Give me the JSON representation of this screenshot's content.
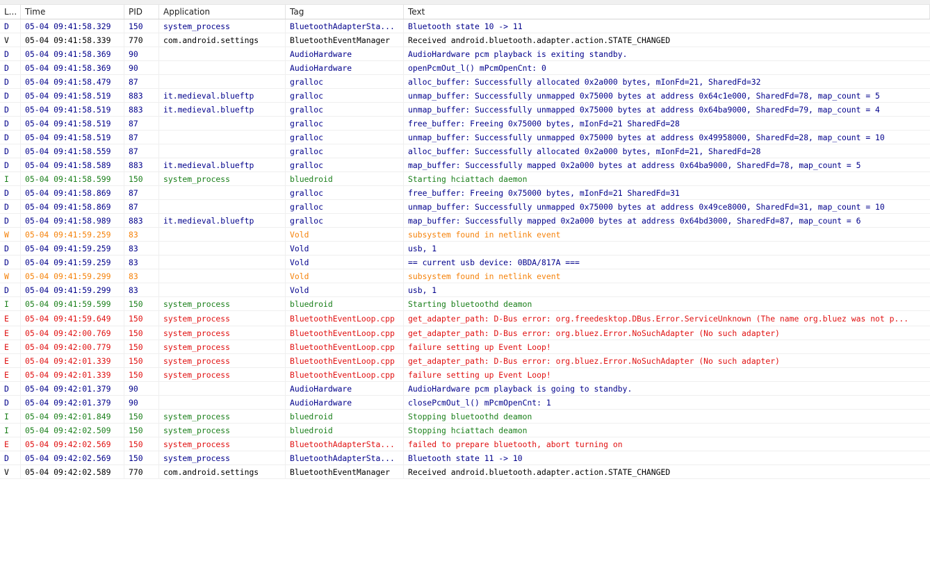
{
  "columns": [
    "L...",
    "Time",
    "PID",
    "Application",
    "Tag",
    "Text"
  ],
  "level_colors": {
    "D": "#00008b",
    "V": "#000000",
    "I": "#1a7f1a",
    "W": "#f5820a",
    "E": "#e01010"
  },
  "rows": [
    {
      "level": "D",
      "time": "05-04 09:41:58.329",
      "pid": "150",
      "app": "system_process",
      "tag": "BluetoothAdapterSta...",
      "text": "Bluetooth state 10 -> 11"
    },
    {
      "level": "V",
      "time": "05-04 09:41:58.339",
      "pid": "770",
      "app": "com.android.settings",
      "tag": "BluetoothEventManager",
      "text": "Received android.bluetooth.adapter.action.STATE_CHANGED"
    },
    {
      "level": "D",
      "time": "05-04 09:41:58.369",
      "pid": "90",
      "app": "",
      "tag": "AudioHardware",
      "text": "AudioHardware pcm playback is exiting standby."
    },
    {
      "level": "D",
      "time": "05-04 09:41:58.369",
      "pid": "90",
      "app": "",
      "tag": "AudioHardware",
      "text": "openPcmOut_l() mPcmOpenCnt: 0"
    },
    {
      "level": "D",
      "time": "05-04 09:41:58.479",
      "pid": "87",
      "app": "",
      "tag": "gralloc",
      "text": "alloc_buffer: Successfully allocated 0x2a000 bytes, mIonFd=21, SharedFd=32"
    },
    {
      "level": "D",
      "time": "05-04 09:41:58.519",
      "pid": "883",
      "app": "it.medieval.blueftp",
      "tag": "gralloc",
      "text": "unmap_buffer: Successfully unmapped 0x75000 bytes at address 0x64c1e000, SharedFd=78, map_count = 5"
    },
    {
      "level": "D",
      "time": "05-04 09:41:58.519",
      "pid": "883",
      "app": "it.medieval.blueftp",
      "tag": "gralloc",
      "text": "unmap_buffer: Successfully unmapped 0x75000 bytes at address 0x64ba9000, SharedFd=79, map_count = 4"
    },
    {
      "level": "D",
      "time": "05-04 09:41:58.519",
      "pid": "87",
      "app": "",
      "tag": "gralloc",
      "text": "free_buffer: Freeing 0x75000 bytes, mIonFd=21 SharedFd=28"
    },
    {
      "level": "D",
      "time": "05-04 09:41:58.519",
      "pid": "87",
      "app": "",
      "tag": "gralloc",
      "text": "unmap_buffer: Successfully unmapped 0x75000 bytes at address 0x49958000, SharedFd=28, map_count = 10"
    },
    {
      "level": "D",
      "time": "05-04 09:41:58.559",
      "pid": "87",
      "app": "",
      "tag": "gralloc",
      "text": "alloc_buffer: Successfully allocated 0x2a000 bytes, mIonFd=21, SharedFd=28"
    },
    {
      "level": "D",
      "time": "05-04 09:41:58.589",
      "pid": "883",
      "app": "it.medieval.blueftp",
      "tag": "gralloc",
      "text": "map_buffer: Successfully mapped 0x2a000 bytes at address 0x64ba9000, SharedFd=78, map_count = 5"
    },
    {
      "level": "I",
      "time": "05-04 09:41:58.599",
      "pid": "150",
      "app": "system_process",
      "tag": "bluedroid",
      "text": "Starting hciattach daemon"
    },
    {
      "level": "D",
      "time": "05-04 09:41:58.869",
      "pid": "87",
      "app": "",
      "tag": "gralloc",
      "text": "free_buffer: Freeing 0x75000 bytes, mIonFd=21 SharedFd=31"
    },
    {
      "level": "D",
      "time": "05-04 09:41:58.869",
      "pid": "87",
      "app": "",
      "tag": "gralloc",
      "text": "unmap_buffer: Successfully unmapped 0x75000 bytes at address 0x49ce8000, SharedFd=31, map_count = 10"
    },
    {
      "level": "D",
      "time": "05-04 09:41:58.989",
      "pid": "883",
      "app": "it.medieval.blueftp",
      "tag": "gralloc",
      "text": "map_buffer: Successfully mapped 0x2a000 bytes at address 0x64bd3000, SharedFd=87, map_count = 6"
    },
    {
      "level": "W",
      "time": "05-04 09:41:59.259",
      "pid": "83",
      "app": "",
      "tag": "Vold",
      "text": "subsystem found in netlink event"
    },
    {
      "level": "D",
      "time": "05-04 09:41:59.259",
      "pid": "83",
      "app": "",
      "tag": "Vold",
      "text": "usb, 1"
    },
    {
      "level": "D",
      "time": "05-04 09:41:59.259",
      "pid": "83",
      "app": "",
      "tag": "Vold",
      "text": "== current usb device: 0BDA/817A ==="
    },
    {
      "level": "W",
      "time": "05-04 09:41:59.299",
      "pid": "83",
      "app": "",
      "tag": "Vold",
      "text": "subsystem found in netlink event"
    },
    {
      "level": "D",
      "time": "05-04 09:41:59.299",
      "pid": "83",
      "app": "",
      "tag": "Vold",
      "text": "usb, 1"
    },
    {
      "level": "I",
      "time": "05-04 09:41:59.599",
      "pid": "150",
      "app": "system_process",
      "tag": "bluedroid",
      "text": "Starting bluetoothd deamon"
    },
    {
      "level": "E",
      "time": "05-04 09:41:59.649",
      "pid": "150",
      "app": "system_process",
      "tag": "BluetoothEventLoop.cpp",
      "text": "get_adapter_path: D-Bus error: org.freedesktop.DBus.Error.ServiceUnknown (The name org.bluez was not p...",
      "tall": true
    },
    {
      "level": "E",
      "time": "05-04 09:42:00.769",
      "pid": "150",
      "app": "system_process",
      "tag": "BluetoothEventLoop.cpp",
      "text": "get_adapter_path: D-Bus error: org.bluez.Error.NoSuchAdapter (No such adapter)"
    },
    {
      "level": "E",
      "time": "05-04 09:42:00.779",
      "pid": "150",
      "app": "system_process",
      "tag": "BluetoothEventLoop.cpp",
      "text": "failure setting up Event Loop!"
    },
    {
      "level": "E",
      "time": "05-04 09:42:01.339",
      "pid": "150",
      "app": "system_process",
      "tag": "BluetoothEventLoop.cpp",
      "text": "get_adapter_path: D-Bus error: org.bluez.Error.NoSuchAdapter (No such adapter)"
    },
    {
      "level": "E",
      "time": "05-04 09:42:01.339",
      "pid": "150",
      "app": "system_process",
      "tag": "BluetoothEventLoop.cpp",
      "text": "failure setting up Event Loop!"
    },
    {
      "level": "D",
      "time": "05-04 09:42:01.379",
      "pid": "90",
      "app": "",
      "tag": "AudioHardware",
      "text": "AudioHardware pcm playback is going to standby."
    },
    {
      "level": "D",
      "time": "05-04 09:42:01.379",
      "pid": "90",
      "app": "",
      "tag": "AudioHardware",
      "text": "closePcmOut_l() mPcmOpenCnt: 1"
    },
    {
      "level": "I",
      "time": "05-04 09:42:01.849",
      "pid": "150",
      "app": "system_process",
      "tag": "bluedroid",
      "text": "Stopping bluetoothd deamon"
    },
    {
      "level": "I",
      "time": "05-04 09:42:02.509",
      "pid": "150",
      "app": "system_process",
      "tag": "bluedroid",
      "text": "Stopping hciattach deamon"
    },
    {
      "level": "E",
      "time": "05-04 09:42:02.569",
      "pid": "150",
      "app": "system_process",
      "tag": "BluetoothAdapterSta...",
      "text": "failed to prepare bluetooth, abort turning on"
    },
    {
      "level": "D",
      "time": "05-04 09:42:02.569",
      "pid": "150",
      "app": "system_process",
      "tag": "BluetoothAdapterSta...",
      "text": "Bluetooth state 11 -> 10"
    },
    {
      "level": "V",
      "time": "05-04 09:42:02.589",
      "pid": "770",
      "app": "com.android.settings",
      "tag": "BluetoothEventManager",
      "text": "Received android.bluetooth.adapter.action.STATE_CHANGED"
    }
  ]
}
